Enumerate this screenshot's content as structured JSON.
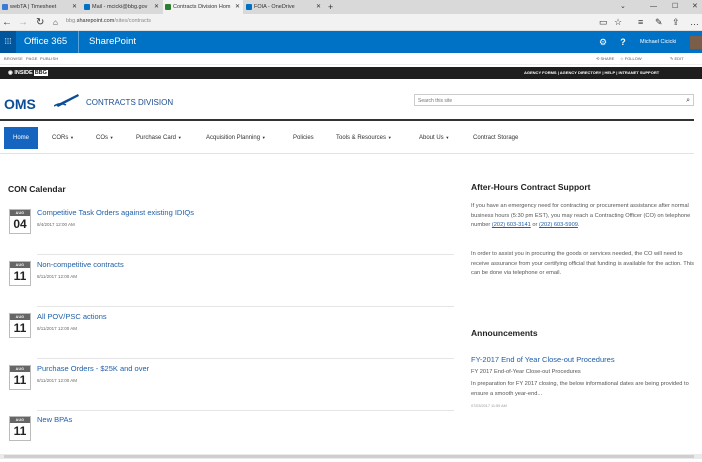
{
  "browser": {
    "tabs": [
      {
        "title": "webTA | Timesheet",
        "favicon_color": "#3a7bd5"
      },
      {
        "title": "Mail - mcicki@bbg.gov",
        "favicon_color": "#0072c6"
      },
      {
        "title": "Contracts Division Hom",
        "favicon_color": "#2e7d32"
      },
      {
        "title": "FOIA - OneDrive",
        "favicon_color": "#0072c6"
      }
    ],
    "url_prefix": "bbg.",
    "url_host": "sharepoint.com",
    "url_path": "/sites/contracts"
  },
  "suite": {
    "office_label": "Office 365",
    "app_label": "SharePoint",
    "user_name": "Michael Cicicki"
  },
  "ribbon": {
    "tabs": [
      "BROWSE",
      "PAGE",
      "PUBLISH"
    ],
    "actions": [
      "SHARE",
      "FOLLOW",
      "EDIT"
    ]
  },
  "inside": {
    "logo": "INSIDE",
    "logo_badge": "BBG",
    "links": "AGENCY FORMS | AGENCY DIRECTORY | HELP | INTRANET SUPPORT"
  },
  "header": {
    "logo_text": "OMS",
    "site_title": "CONTRACTS DIVISION",
    "search_placeholder": "Search this site"
  },
  "nav": [
    {
      "label": "Home",
      "has_menu": false
    },
    {
      "label": "CORs",
      "has_menu": true
    },
    {
      "label": "COs",
      "has_menu": true
    },
    {
      "label": "Purchase Card",
      "has_menu": true
    },
    {
      "label": "Acquisition Planning",
      "has_menu": true
    },
    {
      "label": "Policies",
      "has_menu": false
    },
    {
      "label": "Tools & Resources",
      "has_menu": true
    },
    {
      "label": "About Us",
      "has_menu": true
    },
    {
      "label": "Contract Storage",
      "has_menu": false
    }
  ],
  "calendar": {
    "title": "CON Calendar",
    "events": [
      {
        "month": "AUG",
        "day": "04",
        "title": "Competitive Task Orders against existing IDIQs",
        "time": "8/4/2017 12:00 AM"
      },
      {
        "month": "AUG",
        "day": "11",
        "title": "Non-competitive contracts",
        "time": "8/11/2017 12:00 AM"
      },
      {
        "month": "AUG",
        "day": "11",
        "title": "All POV/PSC actions",
        "time": "8/11/2017 12:00 AM"
      },
      {
        "month": "AUG",
        "day": "11",
        "title": "Purchase Orders - $25K and over",
        "time": "8/11/2017 12:00 AM"
      },
      {
        "month": "AUG",
        "day": "11",
        "title": "New BPAs",
        "time": "8/11/2017 12:00 AM"
      }
    ]
  },
  "after_hours": {
    "title": "After-Hours Contract Support",
    "p1_a": "If you have an emergency need for contracting or procurement assistance after normal business hours (5:30 pm EST), you may reach a Contracting Officer (CO) on telephone number ",
    "phone1": "(202) 603-3141",
    "p1_b": " or ",
    "phone2": "(202) 603-5909",
    "p1_c": ".",
    "p2": "In order to assist you in procuring the goods or services needed, the CO will need to receive assurance from your certifying official that funding is available for the action. This can be done via telephone or email."
  },
  "announcements": {
    "title": "Announcements",
    "item_title": "FY-2017 End of Year Close-out Procedures",
    "item_subtitle": "FY 2017 End-of-Year Close-out Procedures",
    "item_body": "In preparation for FY 2017 closing, the below informational dates are being provided to ensure a smooth year-end...",
    "item_date": "07/03/2017 11:59 AM"
  },
  "colors": {
    "suite_blue": "#0072c6",
    "nav_active": "#1565c0",
    "link_blue": "#1f5fa8",
    "brand_navy": "#0b4d96"
  }
}
